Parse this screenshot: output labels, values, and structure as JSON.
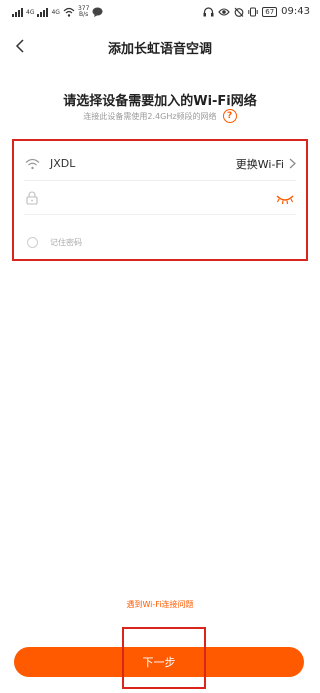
{
  "status_bar": {
    "network_tags": [
      "4G",
      "4G"
    ],
    "speed_value": "377",
    "speed_unit": "B/s",
    "battery": "67",
    "time": "09:43"
  },
  "header": {
    "title": "添加长虹语音空调"
  },
  "main": {
    "subtitle": "请选择设备需要加入的Wi-Fi网络",
    "hint": "连接此设备需使用2.4GHz频段的网络",
    "help_symbol": "?"
  },
  "form": {
    "ssid": "JXDL",
    "change_wifi_label": "更换Wi-Fi",
    "password_value": "",
    "password_placeholder": "",
    "remember_label": "记住密码"
  },
  "footer": {
    "wifi_issue_link": "遇到Wi-Fi连接问题",
    "next_label": "下一步"
  },
  "colors": {
    "accent": "#ff5a00",
    "highlight_border": "#d9261c"
  }
}
